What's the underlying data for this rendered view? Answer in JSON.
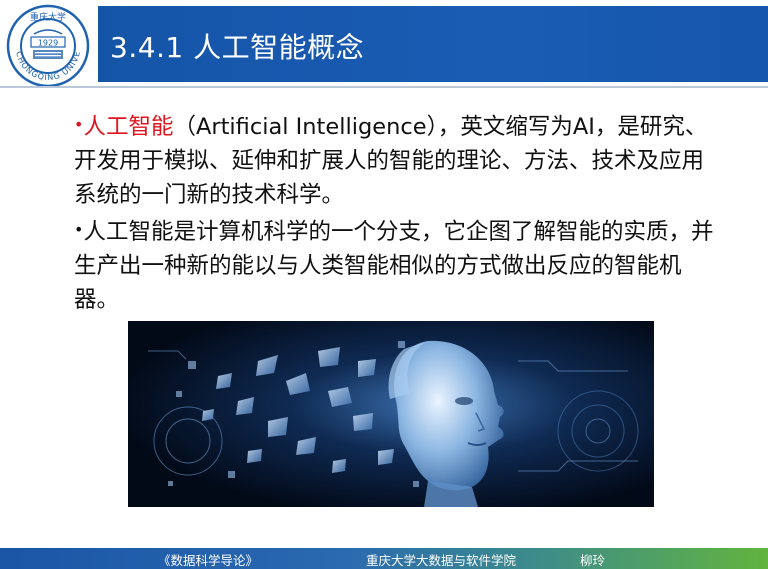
{
  "header": {
    "title": "3.4.1 人工智能概念",
    "logo": {
      "ring_text": "CHONGQING UNIVERSITY",
      "top_text": "重庆大学",
      "year": "1929"
    }
  },
  "content": {
    "paragraph1": {
      "bullet": "•",
      "highlight": "人工智能",
      "rest": "（Artificial Intelligence），英文缩写为AI，是研究、开发用于模拟、延伸和扩展人的智能的理论、方法、技术及应用系统的一门新的技术科学。"
    },
    "paragraph2": {
      "bullet": "•",
      "text": "人工智能是计算机科学的一个分支，它企图了解智能的实质，并生产出一种新的能以与人类智能相似的方式做出反应的智能机器。"
    },
    "image": {
      "icon": "ai-head-illustration"
    }
  },
  "footer": {
    "book": "《数据科学导论》",
    "school": "重庆大学大数据与软件学院",
    "author": "柳玲"
  },
  "colors": {
    "title_bar": "#1a5cb4",
    "highlight": "#e0141e",
    "footer_start": "#1a55a6",
    "footer_end": "#62b43e"
  }
}
